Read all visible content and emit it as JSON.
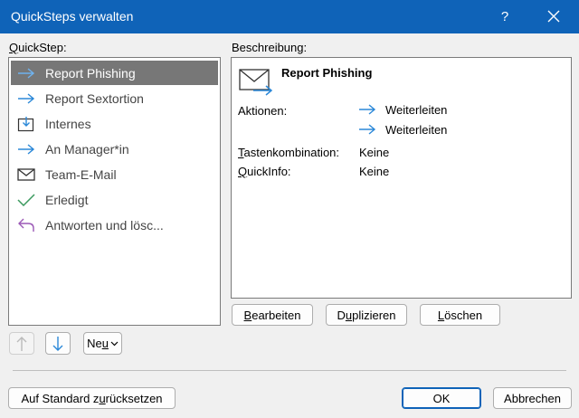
{
  "window": {
    "title": "QuickSteps verwalten",
    "help_label": "?"
  },
  "quicksteps": {
    "label_prefix": "",
    "label_u": "Q",
    "label_rest": "uickStep:",
    "items": [
      {
        "label": "Report Phishing",
        "icon": "arrow-right-icon",
        "selected": true
      },
      {
        "label": "Report Sextortion",
        "icon": "arrow-right-icon"
      },
      {
        "label": "Internes",
        "icon": "move-to-folder-icon"
      },
      {
        "label": "An Manager*in",
        "icon": "arrow-right-icon"
      },
      {
        "label": "Team-E-Mail",
        "icon": "envelope-icon"
      },
      {
        "label": "Erledigt",
        "icon": "checkmark-icon"
      },
      {
        "label": "Antworten und lösc...",
        "icon": "reply-icon"
      }
    ]
  },
  "description": {
    "label": "Beschreibung:",
    "name": "Report Phishing",
    "actions_label": "Aktionen:",
    "actions": [
      "Weiterleiten",
      "Weiterleiten"
    ],
    "shortcut_label_u": "T",
    "shortcut_label_rest": "astenkombination:",
    "shortcut_value": "Keine",
    "quickinfo_label_u": "Q",
    "quickinfo_label_rest": "uickInfo:",
    "quickinfo_value": "Keine"
  },
  "buttons": {
    "edit_u": "B",
    "edit_rest": "earbeiten",
    "duplicate_pre": "D",
    "duplicate_u": "u",
    "duplicate_rest": "plizieren",
    "delete_u": "L",
    "delete_rest": "öschen",
    "new_pre": "Ne",
    "new_u": "u",
    "reset_pre": "Auf Standard z",
    "reset_u": "u",
    "reset_rest": "rücksetzen",
    "ok": "OK",
    "cancel": "Abbrechen"
  },
  "colors": {
    "titlebar": "#0f63b8",
    "arrow": "#2b88d8",
    "check": "#3c9a5f",
    "reply": "#9b59b6"
  }
}
